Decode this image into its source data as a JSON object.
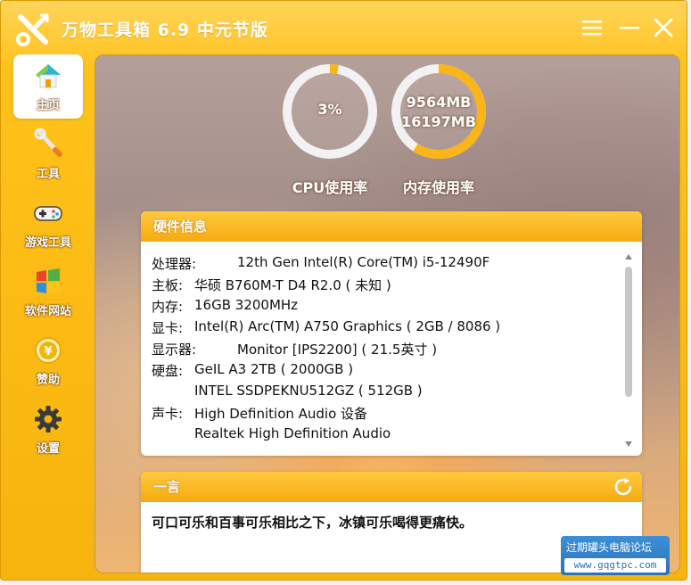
{
  "app": {
    "title": "万物工具箱 6.9 中元节版"
  },
  "window_controls": {
    "menu_icon": "hamburger-icon",
    "min_icon": "minimize-icon",
    "close_icon": "close-icon"
  },
  "sidebar": {
    "items": [
      {
        "label": "主页",
        "icon": "home-icon",
        "active": true
      },
      {
        "label": "工具",
        "icon": "wrench-icon",
        "active": false
      },
      {
        "label": "游戏工具",
        "icon": "gamepad-icon",
        "active": false
      },
      {
        "label": "软件网站",
        "icon": "windows-icon",
        "active": false
      },
      {
        "label": "赞助",
        "icon": "yuan-coin-icon",
        "active": false
      },
      {
        "label": "设置",
        "icon": "gear-icon",
        "active": false
      }
    ]
  },
  "gauges": {
    "cpu": {
      "value_text": "3%",
      "fraction": 0.03,
      "caption": "CPU使用率"
    },
    "memory": {
      "used_text": "9564MB",
      "total_text": "16197MB",
      "fraction": 0.59,
      "caption": "内存使用率"
    }
  },
  "hardware": {
    "title": "硬件信息",
    "rows": [
      {
        "key": "处理器:",
        "value": "12th Gen Intel(R) Core(TM) i5-12490F",
        "wide": true
      },
      {
        "key": "主板:",
        "value": "华硕 B760M-T D4 R2.0 ( 未知 )",
        "wide": false
      },
      {
        "key": "内存:",
        "value": "16GB 3200MHz",
        "wide": false
      },
      {
        "key": "显卡:",
        "value": "Intel(R) Arc(TM) A750 Graphics ( 2GB / 8086 )",
        "wide": false
      },
      {
        "key": "显示器:",
        "value": "Monitor [IPS2200] ( 21.5英寸 )",
        "wide": true
      },
      {
        "key": "硬盘:",
        "value": "GeIL A3 2TB ( 2000GB )",
        "wide": false
      },
      {
        "key": "",
        "value": "INTEL SSDPEKNU512GZ ( 512GB )",
        "wide": false
      },
      {
        "key": "声卡:",
        "value": "High Definition Audio 设备",
        "wide": false
      },
      {
        "key": "",
        "value": "Realtek High Definition Audio",
        "wide": false
      }
    ]
  },
  "quote": {
    "title": "一言",
    "text": "可口可乐和百事可乐相比之下，冰镇可乐喝得更痛快。",
    "refresh_icon": "refresh-icon"
  },
  "watermark": {
    "line1": "过期罐头电脑论坛",
    "line2": "www.gqgtpc.com"
  },
  "colors": {
    "accent": "#f7b30e",
    "gauge_fill": "#f9b51a",
    "gauge_track": "#f2f2f2"
  }
}
